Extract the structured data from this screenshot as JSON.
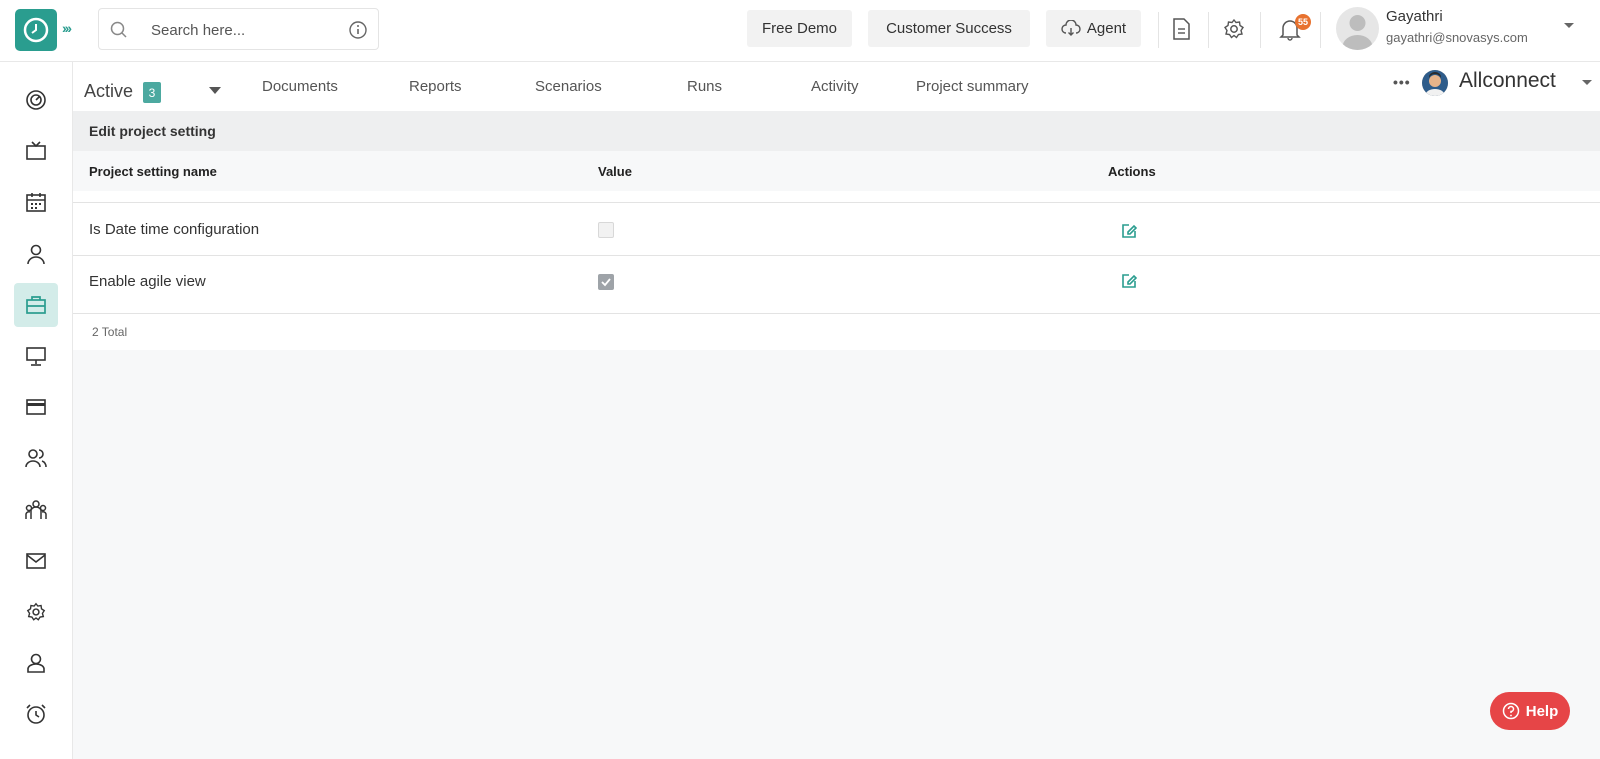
{
  "header": {
    "search_placeholder": "Search here...",
    "free_demo": "Free Demo",
    "customer_success": "Customer Success",
    "agent": "Agent",
    "notification_count": "55",
    "user_name": "Gayathri",
    "user_email": "gayathri@snovasys.com"
  },
  "sidebar": {
    "items": [
      {
        "icon": "dashboard-icon"
      },
      {
        "icon": "tv-icon"
      },
      {
        "icon": "calendar-icon"
      },
      {
        "icon": "user-icon"
      },
      {
        "icon": "briefcase-icon",
        "active": true
      },
      {
        "icon": "monitor-icon"
      },
      {
        "icon": "card-icon"
      },
      {
        "icon": "users-icon"
      },
      {
        "icon": "team-icon"
      },
      {
        "icon": "mail-icon"
      },
      {
        "icon": "settings-icon"
      },
      {
        "icon": "person-icon"
      },
      {
        "icon": "alarm-icon"
      }
    ]
  },
  "subnav": {
    "status": "Active",
    "status_count": "3",
    "tabs": [
      "Documents",
      "Reports",
      "Scenarios",
      "Runs",
      "Activity",
      "Project summary"
    ],
    "more": "•••",
    "project_name": "Allconnect"
  },
  "settings": {
    "title": "Edit project setting",
    "columns": [
      "Project setting name",
      "Value",
      "Actions"
    ],
    "rows": [
      {
        "name": "Is Date time configuration",
        "checked": false
      },
      {
        "name": "Enable agile view",
        "checked": true
      }
    ],
    "total": "2 Total"
  },
  "help": {
    "label": "Help"
  },
  "colors": {
    "accent": "#2a9d8f",
    "help": "#e64547",
    "badge": "#e8722f"
  }
}
